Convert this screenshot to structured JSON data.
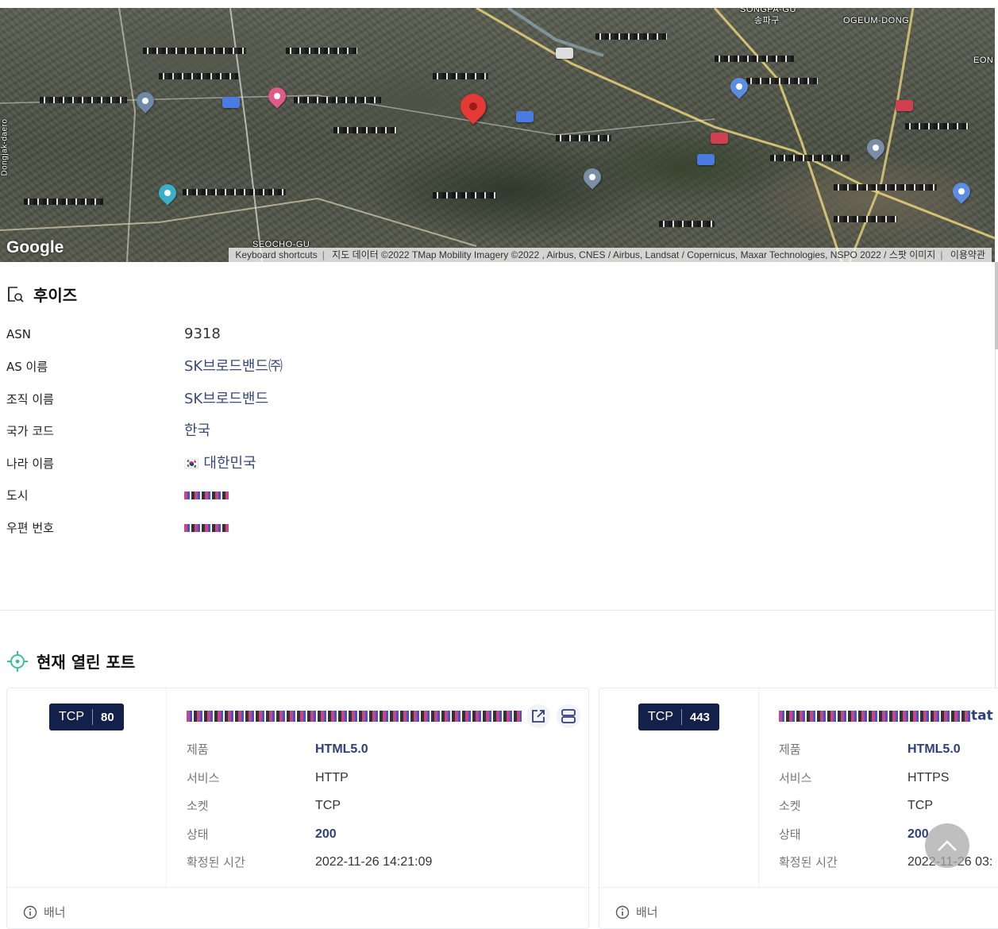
{
  "map": {
    "labels": {
      "songpa": "SONGPA-GU",
      "songpa_ko": "송파구",
      "ogeum": "OGEUM-DONG",
      "seocho": "SEOCHO-GU",
      "dongjak": "Dongjak-daero",
      "eon": "EON"
    },
    "google_logo": "Google",
    "attribution": {
      "shortcuts": "Keyboard shortcuts",
      "data": "지도 데이터 ©2022 TMap Mobility Imagery ©2022 , Airbus, CNES / Airbus, Landsat / Copernicus, Maxar Technologies, NSPO 2022 / 스팟 이미지",
      "terms": "이용약관"
    }
  },
  "whois": {
    "title": "후이즈",
    "rows": [
      {
        "key": "ASN",
        "value": "9318"
      },
      {
        "key": "AS 이름",
        "value": "SK브로드밴드㈜"
      },
      {
        "key": "조직 이름",
        "value": "SK브로드밴드"
      },
      {
        "key": "국가 코드",
        "value": "한국"
      },
      {
        "key": "나라 이름",
        "value": "대한민국",
        "flag": "🇰🇷"
      },
      {
        "key": "도시",
        "value": ""
      },
      {
        "key": "우편 번호",
        "value": ""
      }
    ]
  },
  "ports": {
    "title": "현재 열린 포트",
    "cards": [
      {
        "protocol": "TCP",
        "port": "80",
        "props": [
          {
            "key": "제품",
            "value": "HTML5.0"
          },
          {
            "key": "서비스",
            "value": "HTTP"
          },
          {
            "key": "소켓",
            "value": "TCP"
          },
          {
            "key": "상태",
            "value": "200"
          },
          {
            "key": "확정된 시간",
            "value": "2022-11-26 14:21:09"
          }
        ],
        "banner": "배너"
      },
      {
        "protocol": "TCP",
        "port": "443",
        "title_tail": "tat",
        "props": [
          {
            "key": "제품",
            "value": "HTML5.0"
          },
          {
            "key": "서비스",
            "value": "HTTPS"
          },
          {
            "key": "소켓",
            "value": "TCP"
          },
          {
            "key": "상태",
            "value": "200"
          },
          {
            "key": "확정된 시간",
            "value": "2022-11-26 03:"
          }
        ],
        "banner": "배너"
      }
    ]
  },
  "colors": {
    "navy": "#13204a",
    "link": "#3a4a7a",
    "marker": "#e53935",
    "target_icon": "#3fbf9a"
  },
  "icons": [
    "external-link-icon",
    "server-icon",
    "info-icon",
    "chevron-up-icon",
    "search-doc-icon",
    "target-icon"
  ]
}
